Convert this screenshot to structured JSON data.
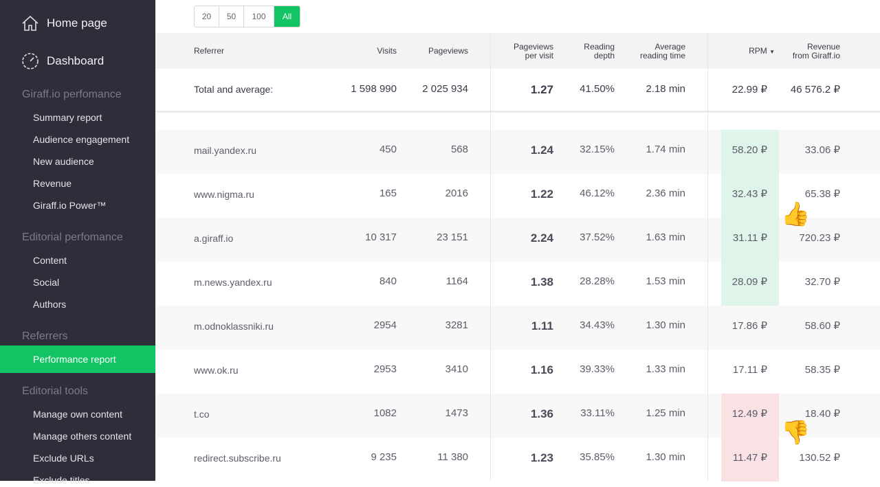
{
  "sidebar": {
    "home": "Home page",
    "dashboard": "Dashboard",
    "sections": [
      {
        "title": "Giraff.io perfomance",
        "items": [
          "Summary report",
          "Audience engagement",
          "New audience",
          "Revenue",
          "Giraff.io Power™"
        ]
      },
      {
        "title": "Editorial perfomance",
        "items": [
          "Content",
          "Social",
          "Authors"
        ]
      },
      {
        "title": "Referrers",
        "items": [
          "Performance report"
        ]
      },
      {
        "title": "Editorial tools",
        "items": [
          "Manage own content",
          "Manage others content",
          "Exclude URLs",
          "Exclude titles"
        ]
      }
    ],
    "active": "Performance report"
  },
  "pager": {
    "options": [
      "20",
      "50",
      "100",
      "All"
    ],
    "selected": "All"
  },
  "table": {
    "headers": {
      "referrer": "Referrer",
      "visits": "Visits",
      "pageviews": "Pageviews",
      "ppv1": "Pageviews",
      "ppv2": "per visit",
      "depth1": "Reading",
      "depth2": "depth",
      "time1": "Average",
      "time2": "reading time",
      "rpm": "RPM",
      "rev1": "Revenue",
      "rev2": "from Giraff.io"
    },
    "sort": {
      "column": "RPM",
      "direction": "desc"
    },
    "total": {
      "label": "Total and average:",
      "visits": "1 598 990",
      "pageviews": "2 025 934",
      "ppv": "1.27",
      "depth": "41.50%",
      "time": "2.18 min",
      "rpm": "22.99 ₽",
      "revenue": "46 576.2 ₽"
    },
    "rows": [
      {
        "referrer": "mail.yandex.ru",
        "visits": "450",
        "pageviews": "568",
        "ppv": "1.24",
        "depth": "32.15%",
        "time": "1.74 min",
        "rpm": "58.20 ₽",
        "revenue": "33.06 ₽",
        "highlight": "good"
      },
      {
        "referrer": "www.nigma.ru",
        "visits": "165",
        "pageviews": "2016",
        "ppv": "1.22",
        "depth": "46.12%",
        "time": "2.36 min",
        "rpm": "32.43 ₽",
        "revenue": "65.38 ₽",
        "highlight": "good"
      },
      {
        "referrer": "a.giraff.io",
        "visits": "10 317",
        "pageviews": "23 151",
        "ppv": "2.24",
        "depth": "37.52%",
        "time": "1.63 min",
        "rpm": "31.11 ₽",
        "revenue": "720.23 ₽",
        "highlight": "good"
      },
      {
        "referrer": "m.news.yandex.ru",
        "visits": "840",
        "pageviews": "1164",
        "ppv": "1.38",
        "depth": "28.28%",
        "time": "1.53 min",
        "rpm": "28.09 ₽",
        "revenue": "32.70 ₽",
        "highlight": "good"
      },
      {
        "referrer": "m.odnoklassniki.ru",
        "visits": "2954",
        "pageviews": "3281",
        "ppv": "1.11",
        "depth": "34.43%",
        "time": "1.30 min",
        "rpm": "17.86 ₽",
        "revenue": "58.60 ₽",
        "highlight": ""
      },
      {
        "referrer": "www.ok.ru",
        "visits": "2953",
        "pageviews": "3410",
        "ppv": "1.16",
        "depth": "39.33%",
        "time": "1.33 min",
        "rpm": "17.11 ₽",
        "revenue": "58.35 ₽",
        "highlight": ""
      },
      {
        "referrer": "t.co",
        "visits": "1082",
        "pageviews": "1473",
        "ppv": "1.36",
        "depth": "33.11%",
        "time": "1.25 min",
        "rpm": "12.49 ₽",
        "revenue": "18.40 ₽",
        "highlight": "bad"
      },
      {
        "referrer": "redirect.subscribe.ru",
        "visits": "9 235",
        "pageviews": "11 380",
        "ppv": "1.23",
        "depth": "35.85%",
        "time": "1.30 min",
        "rpm": "11.47 ₽",
        "revenue": "130.52 ₽",
        "highlight": "bad"
      }
    ]
  },
  "annotations": {
    "good": "👍",
    "bad": "👎"
  },
  "colors": {
    "sidebar": "#2e2e3a",
    "accent": "#12c464",
    "good": "#e0f5ea",
    "bad": "#f9e1e4"
  }
}
